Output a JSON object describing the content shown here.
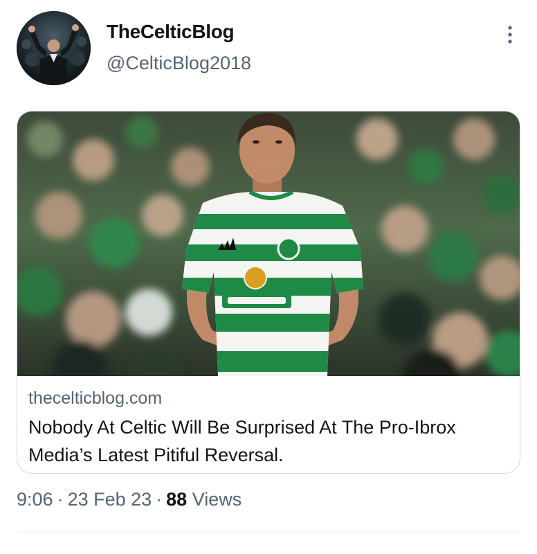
{
  "author": {
    "display_name": "TheCelticBlog",
    "handle": "@CelticBlog2018",
    "avatar_icon": "avatar-manager-photo"
  },
  "more_icon": "more-dots-vertical-icon",
  "card": {
    "image_icon": "player-celebration-photo",
    "domain": "thecelticblog.com",
    "title": "Nobody At Celtic Will Be Surprised At The Pro-Ibrox Media’s Latest Pitiful Reversal."
  },
  "meta": {
    "time": "9:06",
    "separator": "·",
    "date": "23 Feb 23",
    "views_count": "88",
    "views_label": "Views"
  },
  "colors": {
    "secondary_text": "#536471",
    "primary_text": "#0f1419",
    "border": "#cfd9de",
    "celtic_green": "#1f8a45"
  }
}
